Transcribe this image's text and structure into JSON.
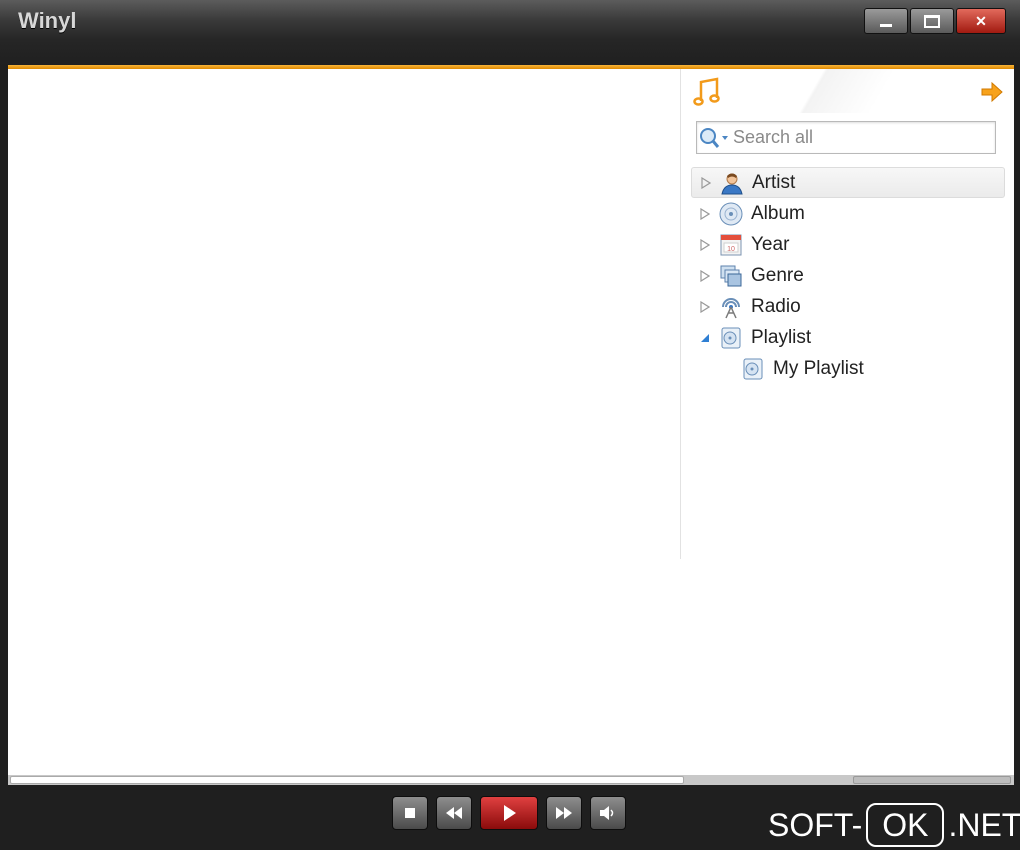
{
  "app": {
    "title": "Winyl"
  },
  "window_controls": {
    "minimize": "minimize",
    "maximize": "maximize",
    "close": "✕"
  },
  "sidebar": {
    "search": {
      "placeholder": "Search all",
      "value": ""
    },
    "tree": [
      {
        "label": "Artist",
        "icon": "artist-icon",
        "expanded": false,
        "selected": true
      },
      {
        "label": "Album",
        "icon": "album-icon",
        "expanded": false
      },
      {
        "label": "Year",
        "icon": "year-calendar-icon",
        "expanded": false
      },
      {
        "label": "Genre",
        "icon": "genre-icon",
        "expanded": false
      },
      {
        "label": "Radio",
        "icon": "radio-icon",
        "expanded": false
      },
      {
        "label": "Playlist",
        "icon": "playlist-icon",
        "expanded": true,
        "children": [
          {
            "label": "My Playlist",
            "icon": "playlist-icon"
          }
        ]
      }
    ]
  },
  "player": {
    "buttons": [
      "stop",
      "previous",
      "play",
      "next",
      "volume"
    ]
  },
  "watermark": {
    "left": "SOFT-",
    "box": "OK",
    "right": ".NET"
  },
  "colors": {
    "accent": "#f0a020",
    "play": "#c01515"
  }
}
